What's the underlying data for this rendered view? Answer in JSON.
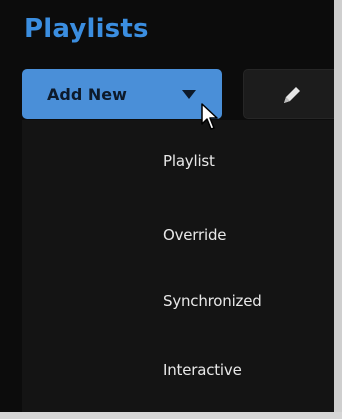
{
  "header": {
    "title": "Playlists"
  },
  "toolbar": {
    "add_new_label": "Add New",
    "caret_icon": "caret-down-icon",
    "edit_icon": "pencil-icon"
  },
  "dropdown": {
    "items": [
      {
        "label": "Playlist"
      },
      {
        "label": "Override"
      },
      {
        "label": "Synchronized"
      },
      {
        "label": "Interactive"
      }
    ]
  },
  "colors": {
    "title": "#3b8ee0",
    "add_new_bg": "#4a8fd8",
    "background": "#0c0c0c",
    "menu_bg": "#141414",
    "menu_text": "#e8e8e8"
  }
}
